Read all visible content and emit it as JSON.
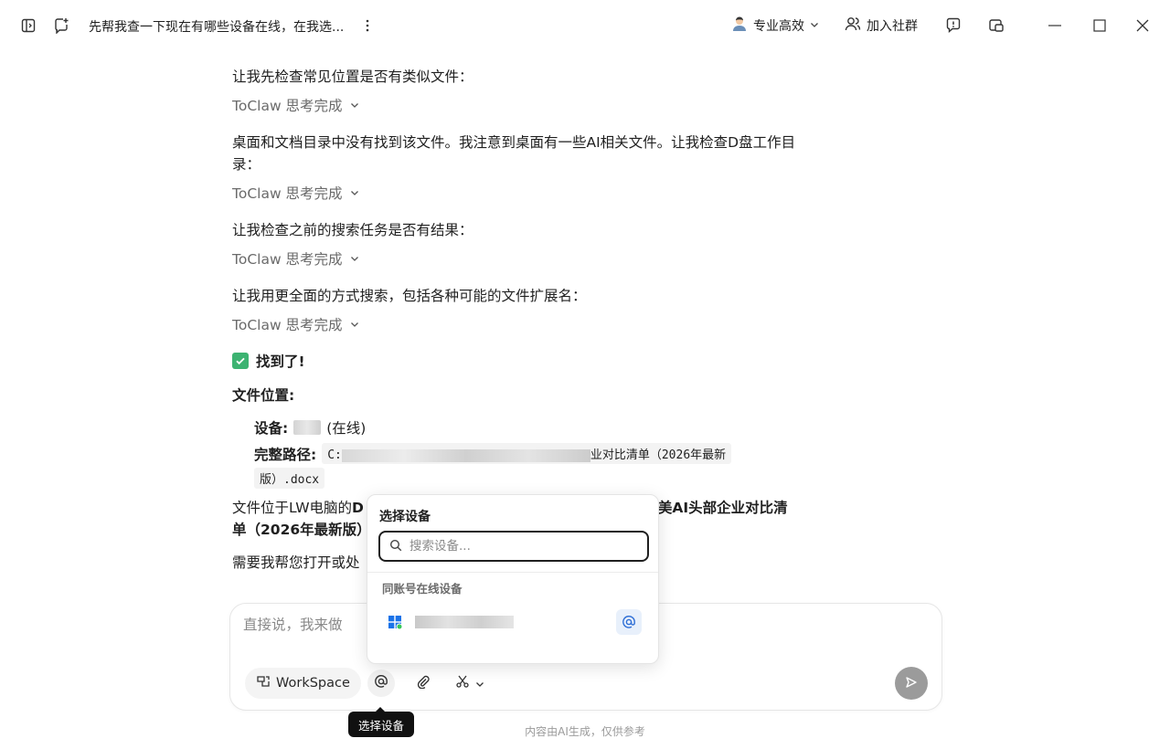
{
  "titlebar": {
    "title": "先帮我查一下现在有哪些设备在线，在我选...",
    "mode_label": "专业高效",
    "community_label": "加入社群"
  },
  "chat": {
    "messages": [
      "让我先检查常见位置是否有类似文件：",
      "桌面和文档目录中没有找到该文件。我注意到桌面有一些AI相关文件。让我检查D盘工作目录：",
      "让我检查之前的搜索任务是否有结果：",
      "让我用更全面的方式搜索，包括各种可能的文件扩展名："
    ],
    "think_label": "ToClaw 思考完成",
    "found_title": "找到了!",
    "location_title": "文件位置:",
    "device_label": "设备:",
    "device_status": "(在线)",
    "path_label": "完整路径:",
    "path_prefix": "C:",
    "path_suffix": "业对比清单（2026年最新",
    "path_end": "版）.docx",
    "summary_start": "文件位于LW电脑的",
    "summary_bold_start": "D",
    "summary_bold_end": "美AI头部企业对比清",
    "summary_line2": "单（2026年最新版）",
    "followup": "需要我帮您打开或处"
  },
  "composer": {
    "placeholder": "直接说，我来做",
    "workspace_label": "WorkSpace"
  },
  "popup": {
    "title": "选择设备",
    "search_placeholder": "搜索设备...",
    "section_label": "同账号在线设备"
  },
  "tooltip": "选择设备",
  "disclaimer": "内容由AI生成，仅供参考",
  "icons": {
    "sidebar": "sidebar-toggle-icon",
    "new_chat": "new-chat-icon",
    "more": "more-vertical-icon",
    "mode_avatar": "avatar-icon",
    "community": "people-icon",
    "feedback": "feedback-icon",
    "window_mode": "window-mode-icon",
    "minimize": "minimize-icon",
    "maximize": "maximize-icon",
    "close": "close-icon"
  },
  "colors": {
    "accent_green": "#3cb371",
    "send_disabled": "#9b9b9b",
    "at_blue": "#2f6fd6"
  }
}
